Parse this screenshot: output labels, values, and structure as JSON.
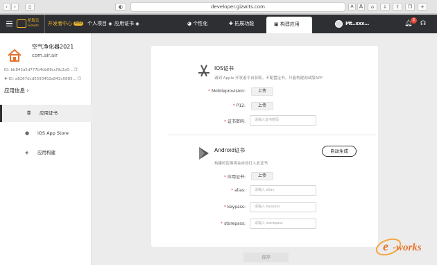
{
  "browser": {
    "url": "developer.gizwits.com",
    "font_small": "A",
    "font_large": "A"
  },
  "header": {
    "logo_cn": "机智云",
    "logo_en": "Gizwits",
    "dev_center": "开发者中心",
    "beta": "Beta",
    "personal_project": "个人项目",
    "app_cert": "应用证书",
    "tabs": [
      "个性化",
      "拓展功能",
      "构建应用"
    ],
    "notification_count": "2",
    "user_name": "Mt..xxx..."
  },
  "sidebar": {
    "device_name": "空气净化器2021",
    "product_key": "com.air.air",
    "id_ios": "ID: bb842a5d777b4db88ccf9c2a0...",
    "id_android": "ID: a8267dcd5593452a842c0885...",
    "app_info": "应用信息",
    "nav": [
      {
        "label": "应用证书",
        "icon": "certificate-icon"
      },
      {
        "label": "iOS App Store",
        "icon": "apple-icon"
      },
      {
        "label": "应用构建",
        "icon": "build-icon"
      }
    ]
  },
  "ios": {
    "title": "IOS证书",
    "desc": "请到 Apple 开发者平台获取，不配置证书，只能构建测试版APP",
    "mobileprovision_label": "Mobileprovision:",
    "p12_label": "P12:",
    "password_label": "证书密码:",
    "upload": "上传",
    "password_placeholder": "请输入证书密码"
  },
  "android": {
    "title": "Android证书",
    "desc": "构建的应用将会自动打入此证书",
    "cert_label": "应用证书:",
    "alias_label": "alias:",
    "keypass_label": "keypass:",
    "storepass_label": "storepass:",
    "upload": "上传",
    "alias_placeholder": "请输入 alias",
    "keypass_placeholder": "请输入 keypass",
    "storepass_placeholder": "请输入 storepass",
    "auto_generate": "自动生成"
  },
  "footer": {
    "save": "保存"
  },
  "watermark": "e-works",
  "colors": {
    "header_bg": "#2d2f33",
    "accent": "#f0b429",
    "badge": "#e74c3c",
    "required": "#e74c3c"
  }
}
